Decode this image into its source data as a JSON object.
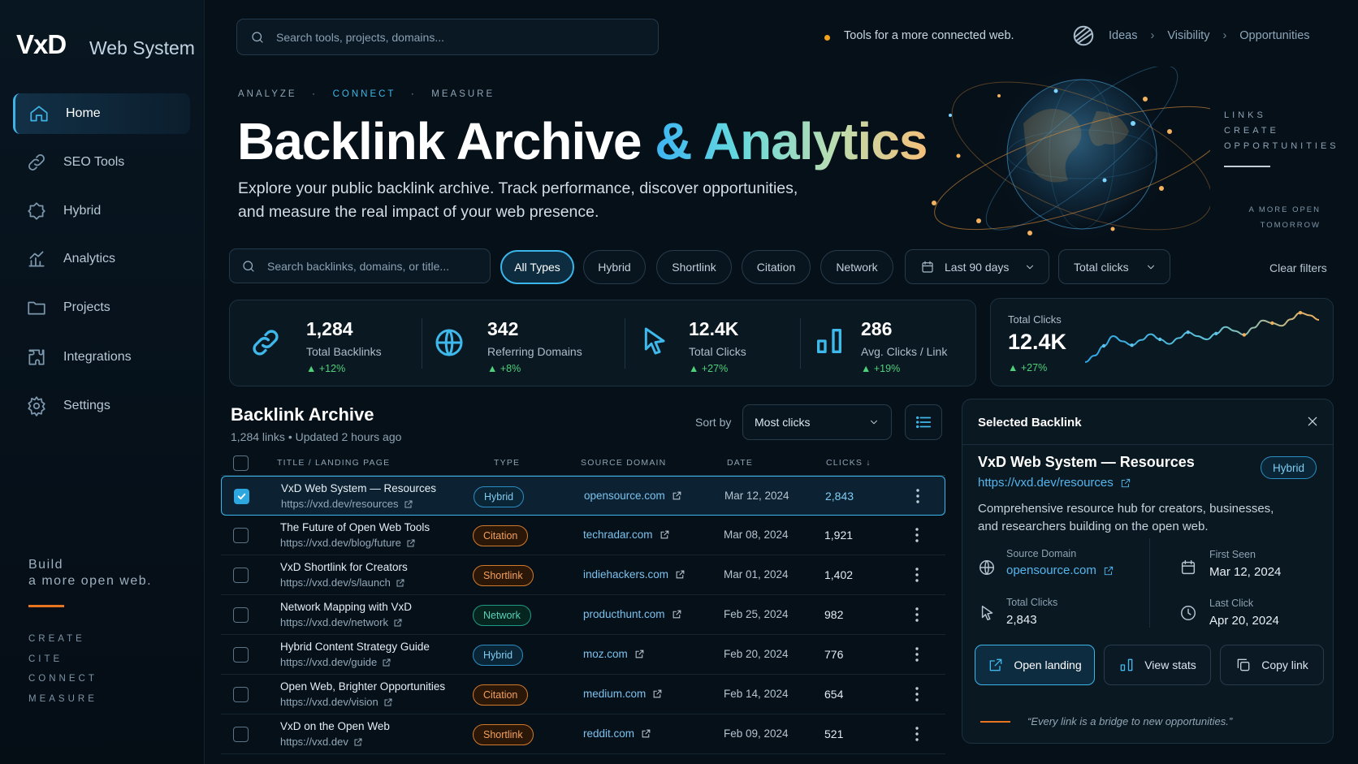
{
  "brand": {
    "logo": "VxD",
    "name": "Web System"
  },
  "sidebar": {
    "items": [
      {
        "label": "Home",
        "icon": "home-icon"
      },
      {
        "label": "SEO Tools",
        "icon": "link-icon"
      },
      {
        "label": "Hybrid",
        "icon": "hybrid-icon"
      },
      {
        "label": "Analytics",
        "icon": "analytics-icon"
      },
      {
        "label": "Projects",
        "icon": "folder-icon"
      },
      {
        "label": "Integrations",
        "icon": "integrations-icon"
      },
      {
        "label": "Settings",
        "icon": "gear-icon"
      }
    ],
    "build_line1": "Build",
    "build_line2": "a more open web.",
    "words": [
      "CREATE",
      "CITE",
      "CONNECT",
      "MEASURE"
    ]
  },
  "topbar": {
    "search_placeholder": "Search tools, projects, domains...",
    "tagline": "Tools for a more connected web.",
    "breadcrumb": [
      "Ideas",
      "Visibility",
      "Opportunities"
    ]
  },
  "hero": {
    "eyebrow": [
      "ANALYZE",
      "CONNECT",
      "MEASURE"
    ],
    "title_main": "Backlink Archive",
    "title_accent": "& Analytics",
    "desc_line1": "Explore your public backlink archive. Track performance, discover opportunities,",
    "desc_line2": "and measure the real impact of your web presence.",
    "right_words": [
      "LINKS",
      "CREATE",
      "OPPORTUNITIES"
    ],
    "right_note": [
      "A MORE OPEN",
      "TOMORROW"
    ]
  },
  "filters": {
    "search_placeholder": "Search backlinks, domains, or title...",
    "chips": [
      "All Types",
      "Hybrid",
      "Shortlink",
      "Citation",
      "Network"
    ],
    "active_chip": "All Types",
    "date_range": "Last 90 days",
    "metric": "Total clicks",
    "clear": "Clear filters"
  },
  "stats": [
    {
      "value": "1,284",
      "label": "Total Backlinks",
      "delta": "+12%",
      "icon": "link-icon"
    },
    {
      "value": "342",
      "label": "Referring Domains",
      "delta": "+8%",
      "icon": "globe-icon"
    },
    {
      "value": "12.4K",
      "label": "Total Clicks",
      "delta": "+27%",
      "icon": "cursor-icon"
    },
    {
      "value": "286",
      "label": "Avg. Clicks / Link",
      "delta": "+19%",
      "icon": "bar-chart-icon"
    }
  ],
  "trend": {
    "label": "Total Clicks",
    "value": "12.4K",
    "delta": "+27%"
  },
  "chart_data": {
    "type": "line",
    "series": [
      {
        "values": [
          2,
          3,
          4.5,
          6,
          5.2,
          4.6,
          5.4,
          6.3,
          5.5,
          4.8,
          5.7,
          6.6,
          6,
          5.5,
          6.4,
          7.4,
          6.8,
          6.2,
          7.3,
          8.4,
          8,
          7.6,
          8.6,
          9.6,
          9.2,
          8.5
        ]
      }
    ]
  },
  "table": {
    "title": "Backlink Archive",
    "count": "1,284 links",
    "updated": "Updated 2 hours ago",
    "sort_label": "Sort by",
    "sort_value": "Most clicks",
    "columns": [
      "TITLE / LANDING PAGE",
      "TYPE",
      "SOURCE DOMAIN",
      "DATE",
      "CLICKS"
    ],
    "rows": [
      {
        "title": "VxD Web System — Resources",
        "url": "https://vxd.dev/resources",
        "type": "Hybrid",
        "domain": "opensource.com",
        "date": "Mar 12, 2024",
        "clicks": "2,843",
        "selected": true
      },
      {
        "title": "The Future of Open Web Tools",
        "url": "https://vxd.dev/blog/future",
        "type": "Citation",
        "domain": "techradar.com",
        "date": "Mar 08, 2024",
        "clicks": "1,921",
        "selected": false
      },
      {
        "title": "VxD Shortlink for Creators",
        "url": "https://vxd.dev/s/launch",
        "type": "Shortlink",
        "domain": "indiehackers.com",
        "date": "Mar 01, 2024",
        "clicks": "1,402",
        "selected": false
      },
      {
        "title": "Network Mapping with VxD",
        "url": "https://vxd.dev/network",
        "type": "Network",
        "domain": "producthunt.com",
        "date": "Feb 25, 2024",
        "clicks": "982",
        "selected": false
      },
      {
        "title": "Hybrid Content Strategy Guide",
        "url": "https://vxd.dev/guide",
        "type": "Hybrid",
        "domain": "moz.com",
        "date": "Feb 20, 2024",
        "clicks": "776",
        "selected": false
      },
      {
        "title": "Open Web, Brighter Opportunities",
        "url": "https://vxd.dev/vision",
        "type": "Citation",
        "domain": "medium.com",
        "date": "Feb 14, 2024",
        "clicks": "654",
        "selected": false
      },
      {
        "title": "VxD on the Open Web",
        "url": "https://vxd.dev",
        "type": "Shortlink",
        "domain": "reddit.com",
        "date": "Feb 09, 2024",
        "clicks": "521",
        "selected": false
      }
    ]
  },
  "panel": {
    "heading": "Selected Backlink",
    "title": "VxD Web System — Resources",
    "badge": "Hybrid",
    "url": "https://vxd.dev/resources",
    "desc_line1": "Comprehensive resource hub for creators, businesses,",
    "desc_line2": "and researchers building on the open web.",
    "source_label": "Source Domain",
    "source_value": "opensource.com",
    "first_label": "First Seen",
    "first_value": "Mar 12, 2024",
    "clicks_label": "Total Clicks",
    "clicks_value": "2,843",
    "last_label": "Last Click",
    "last_value": "Apr 20, 2024",
    "buttons": [
      "Open landing",
      "View stats",
      "Copy link"
    ],
    "quote": "“Every link is a bridge to new opportunities.”"
  },
  "colors": {
    "accent": "#3cb5ea",
    "orange": "#e8741f",
    "positive": "#4fd07a",
    "bg": "#061019"
  }
}
